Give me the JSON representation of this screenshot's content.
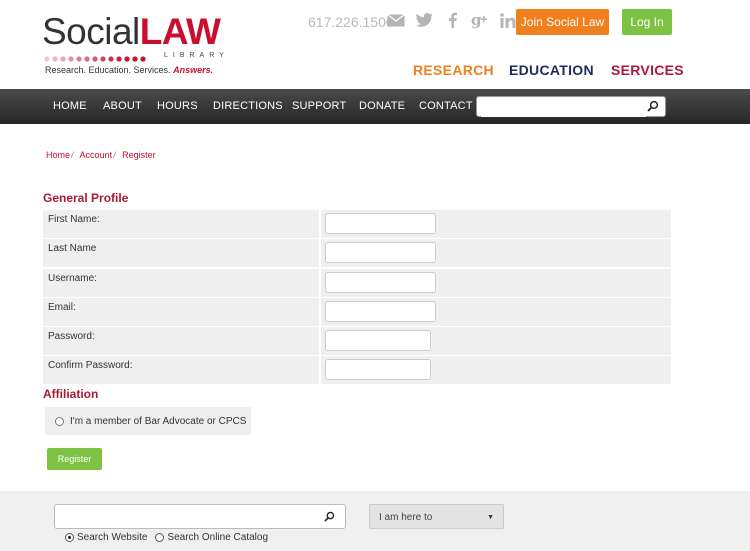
{
  "header": {
    "logo": {
      "social": "Social",
      "law": "LAW",
      "library": "LIBRARY",
      "tagline": "Research. Education. Services.",
      "tagline_accent": "Answers."
    },
    "phone": "617.226.1500",
    "join_label": "Join Social Law",
    "login_label": "Log In",
    "main_nav": {
      "research": "RESEARCH",
      "education": "EDUCATION",
      "services": "SERVICES"
    },
    "social_icons": [
      "mail-icon",
      "twitter-icon",
      "facebook-icon",
      "google-plus-icon",
      "linkedin-icon"
    ]
  },
  "navbar": {
    "items": [
      "HOME",
      "ABOUT",
      "HOURS",
      "DIRECTIONS",
      "SUPPORT",
      "DONATE",
      "CONTACT"
    ],
    "search_value": ""
  },
  "breadcrumb": [
    "Home",
    "Account",
    "Register"
  ],
  "general_profile": {
    "title": "General Profile",
    "fields": [
      {
        "label": "First Name:",
        "value": ""
      },
      {
        "label": "Last Name",
        "value": ""
      },
      {
        "label": "Username:",
        "value": ""
      },
      {
        "label": "Email:",
        "value": ""
      },
      {
        "label": "Password:",
        "value": ""
      },
      {
        "label": "Confirm Password:",
        "value": ""
      }
    ]
  },
  "affiliation": {
    "title": "Affiliation",
    "option": "I'm a member of Bar Advocate or CPCS"
  },
  "register_label": "Register",
  "footer": {
    "search_value": "",
    "select_value": "I am here to",
    "radio_website": "Search Website",
    "radio_catalog": "Search Online Catalog"
  },
  "colors": {
    "orange": "#f07f1e",
    "green": "#7dc242",
    "red": "#c8102e",
    "navy": "#1f2b5e"
  }
}
